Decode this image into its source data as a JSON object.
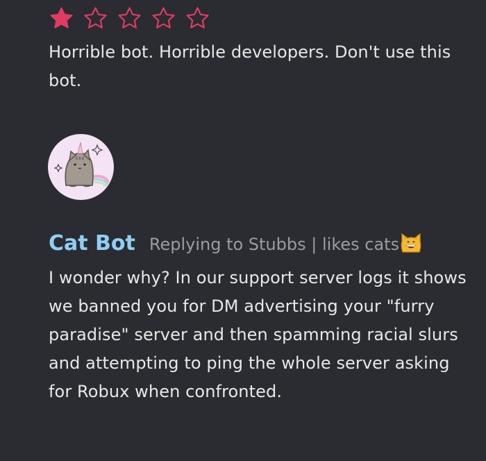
{
  "review": {
    "rating": 1,
    "max_rating": 5,
    "star_color": "#e23b62",
    "text": "Horrible bot. Horrible developers. Don't use this bot."
  },
  "reply": {
    "author": "Cat Bot",
    "author_color": "#8fcff4",
    "meta": "Replying to Stubbs | likes cats",
    "meta_icon": "grinning-cat-emoji",
    "text": "I wonder why? In our support server logs it shows we banned you for DM advertising your \"furry paradise\" server and then spamming racial slurs and attempting to ping the whole server asking for Robux when confronted."
  },
  "avatar": {
    "icon": "unicorn-cat-avatar",
    "background": "#f3e3f5"
  }
}
